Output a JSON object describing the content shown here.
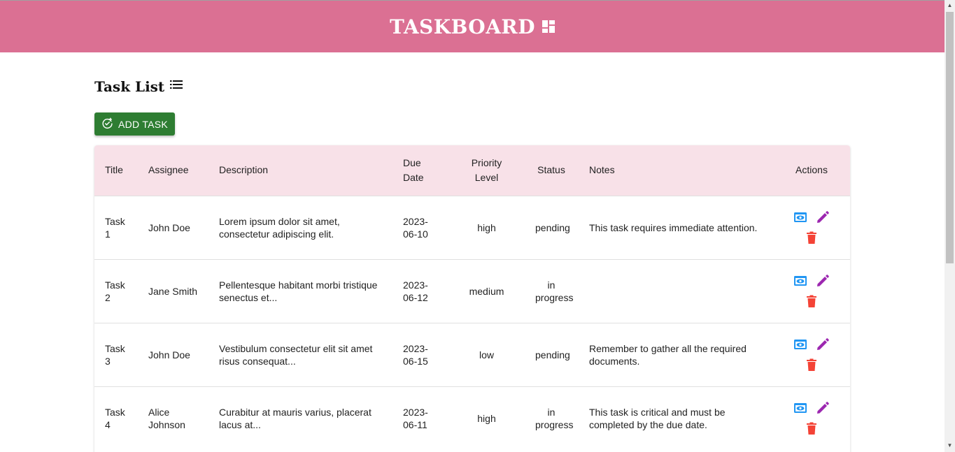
{
  "header": {
    "title": "TASKBOARD",
    "icon": "dashboard-icon",
    "color": "#db7093"
  },
  "page": {
    "title": "Task List",
    "title_icon": "list-icon"
  },
  "toolbar": {
    "add_label": "ADD TASK",
    "add_icon": "add-task-icon",
    "add_color": "#2e7d32"
  },
  "table": {
    "columns": [
      "Title",
      "Assignee",
      "Description",
      "Due Date",
      "Priority Level",
      "Status",
      "Notes",
      "Actions"
    ],
    "header_color": "#f8e1e8",
    "rows": [
      {
        "title": "Task 1",
        "assignee": "John Doe",
        "description": "Lorem ipsum dolor sit amet, consectetur adipiscing elit.",
        "due_date": "2023-06-10",
        "priority": "high",
        "status": "pending",
        "notes": "This task requires immediate attention."
      },
      {
        "title": "Task 2",
        "assignee": "Jane Smith",
        "description": "Pellentesque habitant morbi tristique senectus et...",
        "due_date": "2023-06-12",
        "priority": "medium",
        "status": "in progress",
        "notes": ""
      },
      {
        "title": "Task 3",
        "assignee": "John Doe",
        "description": "Vestibulum consectetur elit sit amet risus consequat...",
        "due_date": "2023-06-15",
        "priority": "low",
        "status": "pending",
        "notes": "Remember to gather all the required documents."
      },
      {
        "title": "Task 4",
        "assignee": "Alice Johnson",
        "description": "Curabitur at mauris varius, placerat lacus at...",
        "due_date": "2023-06-11",
        "priority": "high",
        "status": "in progress",
        "notes": "This task is critical and must be completed by the due date."
      }
    ],
    "actions": {
      "view_icon": "eye-icon",
      "edit_icon": "pencil-icon",
      "delete_icon": "trash-icon",
      "view_color": "#2196f3",
      "edit_color": "#9c27b0",
      "delete_color": "#f44336"
    }
  }
}
